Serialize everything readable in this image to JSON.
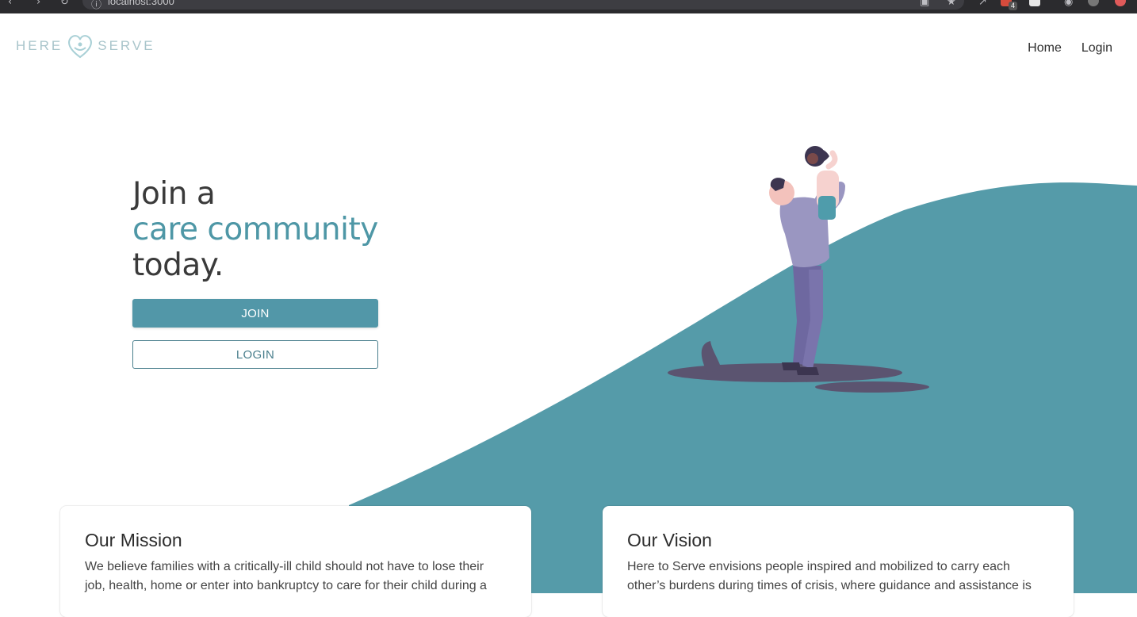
{
  "browser": {
    "url": "localhost:3000",
    "extension_badge": "4"
  },
  "header": {
    "logo_left": "HERE",
    "logo_right": "SERVE",
    "nav": [
      {
        "label": "Home"
      },
      {
        "label": "Login"
      }
    ]
  },
  "hero": {
    "line1": "Join a",
    "line2": "care community",
    "line3": "today.",
    "join_label": "JOIN",
    "login_label": "LOGIN"
  },
  "mission": {
    "title": "Our Mission",
    "text": "We believe families with a critically-ill child should not have to lose their job, health, home or enter into bankruptcy to care for their child during a"
  },
  "vision": {
    "title": "Our Vision",
    "text": "Here to Serve envisions people inspired and mobilized to carry each other’s burdens during times of crisis, where guidance and assistance is"
  },
  "colors": {
    "accent": "#5297a8",
    "text_dark": "#3a3a3a",
    "logo": "#a9c5cb"
  }
}
